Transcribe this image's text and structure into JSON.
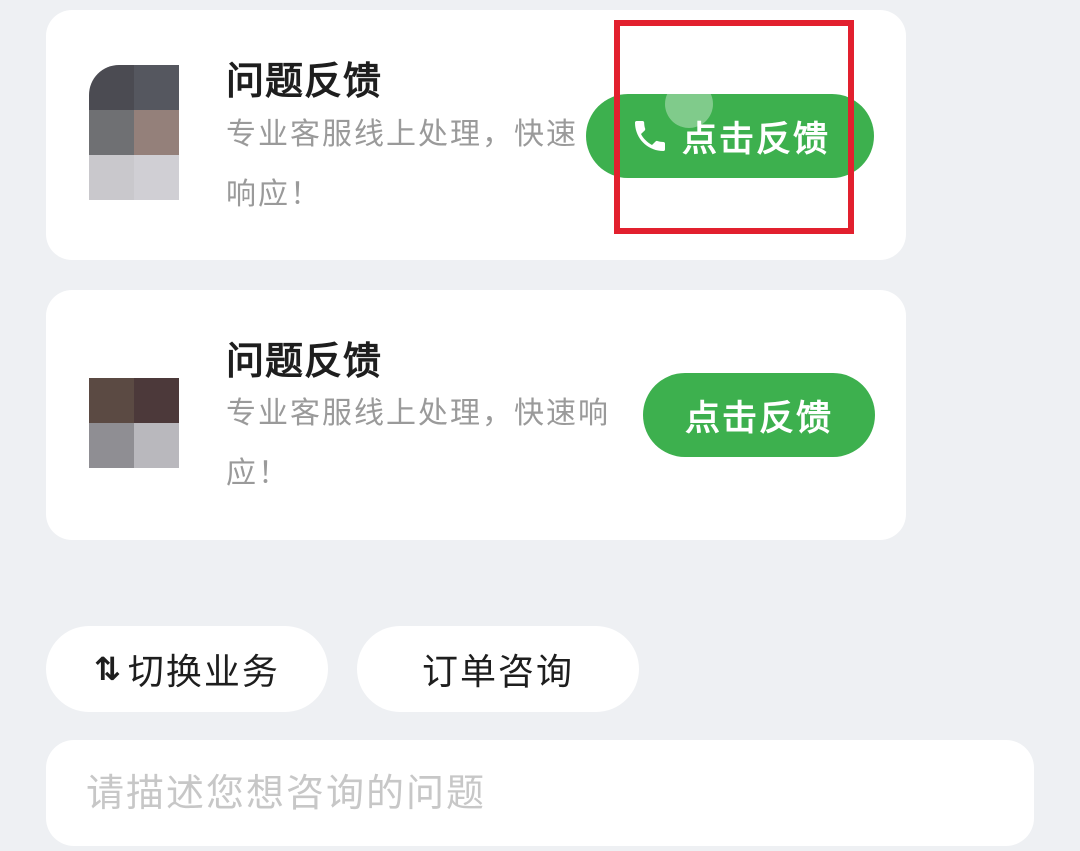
{
  "cards": [
    {
      "title": "问题反馈",
      "description": "专业客服线上处理，快速响应！",
      "button_label": "点击反馈",
      "button_icon": "phone-icon"
    },
    {
      "title": "问题反馈",
      "description": "专业客服线上处理，快速响应！",
      "button_label": "点击反馈"
    }
  ],
  "quick_actions": {
    "switch_icon": "⇅",
    "switch_label": "切换业务",
    "order_label": "订单咨询"
  },
  "input": {
    "placeholder": "请描述您想咨询的问题",
    "value": ""
  },
  "colors": {
    "accent_green": "#3db04e",
    "highlight_red": "#e2202e",
    "background": "#eef0f3"
  }
}
